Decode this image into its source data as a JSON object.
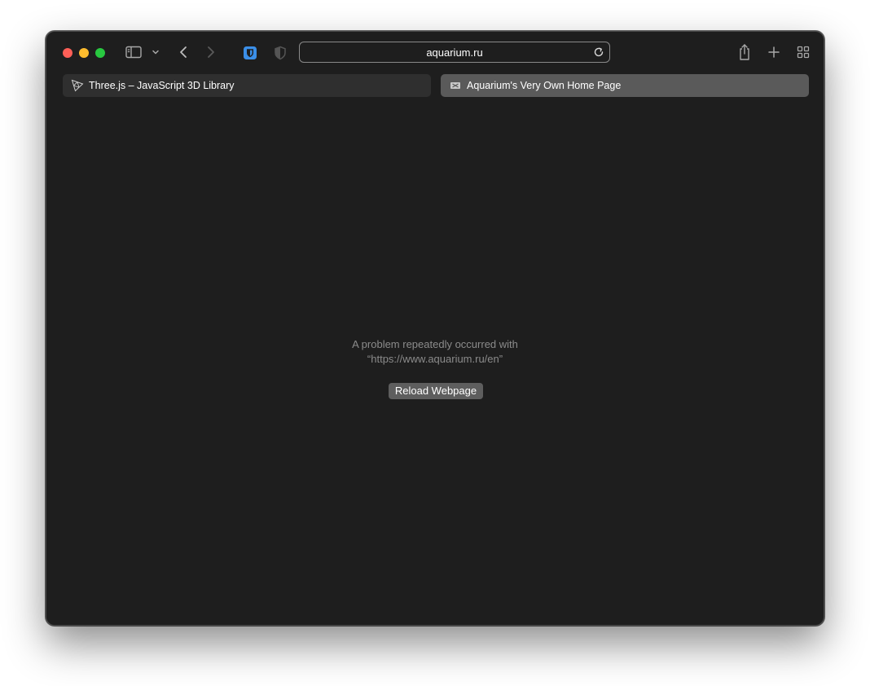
{
  "toolbar": {
    "url": "aquarium.ru",
    "icons": {
      "sidebar": "sidebar-icon",
      "sidebar_menu": "chevron-down-icon",
      "back": "chevron-left-icon",
      "forward": "chevron-right-icon",
      "extension_1": "bitwarden-shield-icon",
      "extension_2": "privacy-shield-icon",
      "reload": "reload-icon",
      "share": "share-icon",
      "new_tab": "plus-icon",
      "tab_overview": "grid-icon"
    }
  },
  "tabs": [
    {
      "title": "Three.js – JavaScript 3D Library",
      "favicon": "threejs-icon",
      "active": false
    },
    {
      "title": "Aquarium's Very Own Home Page",
      "favicon": "page-icon",
      "active": true
    }
  ],
  "error": {
    "line1": "A problem repeatedly occurred with",
    "line2": "“https://www.aquarium.ru/en”",
    "button_label": "Reload Webpage"
  },
  "colors": {
    "window_bg": "#1e1e1e",
    "close": "#fe5f57",
    "minimize": "#febc2e",
    "maximize": "#28c840",
    "active_tab": "#5a5a5a",
    "inactive_tab": "#2f2f2f",
    "extension_blue": "#3b8fe8"
  }
}
